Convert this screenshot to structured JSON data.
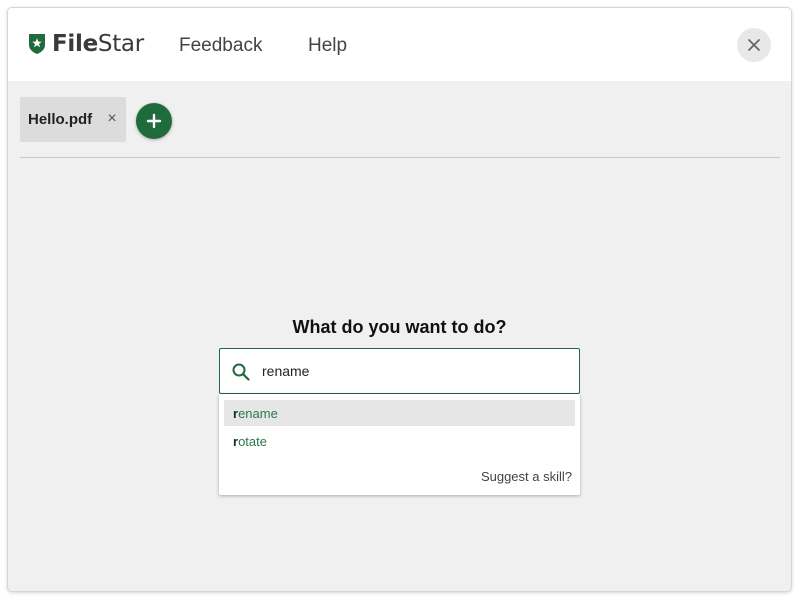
{
  "app": {
    "name_part1": "File",
    "name_part2": "Star",
    "brand_color": "#1f6b3b"
  },
  "header": {
    "nav": {
      "feedback": "Feedback",
      "help": "Help"
    },
    "close_icon": "close-icon"
  },
  "tabs": {
    "items": [
      {
        "label": "Hello.pdf",
        "close_glyph": "×"
      }
    ],
    "add_icon": "plus-icon"
  },
  "main": {
    "prompt": "What do you want to do?",
    "search": {
      "value": "rename",
      "icon": "search-icon"
    },
    "suggestions": [
      {
        "match": "r",
        "rest": "ename",
        "highlighted": true
      },
      {
        "match": "r",
        "rest": "otate",
        "highlighted": false
      }
    ],
    "suggest_skill": "Suggest a skill?"
  }
}
